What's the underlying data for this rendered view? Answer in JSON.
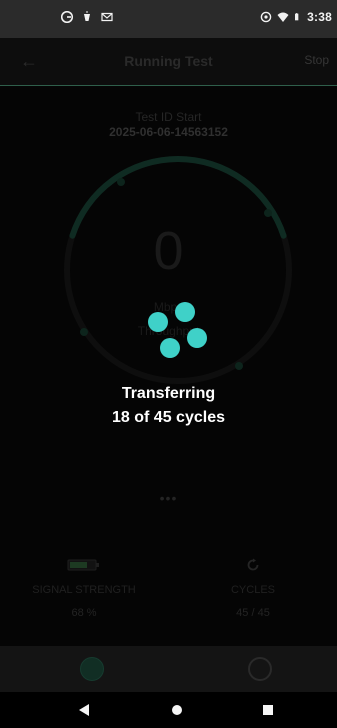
{
  "status_bar": {
    "time": "3:38",
    "left_icons": [
      "google-icon",
      "silent-icon",
      "gmail-icon"
    ],
    "right_icons": [
      "sync-icon",
      "wifi-icon",
      "battery-icon"
    ]
  },
  "header": {
    "title": "Running Test",
    "action_label": "Stop"
  },
  "test": {
    "label": "Test ID Start",
    "id": "2025-06-06-14563152"
  },
  "gauge": {
    "value": "0",
    "unit_line_1": "Mbps",
    "unit_line_2": "Throughput",
    "progress": 0.4
  },
  "dots": "•••",
  "metrics": [
    {
      "icon": "battery-icon",
      "label": "SIGNAL STRENGTH",
      "value": "68 %"
    },
    {
      "icon": "refresh-icon",
      "label": "CYCLES",
      "value": "45 / 45"
    }
  ],
  "overlay": {
    "line_1": "Transferring",
    "line_2": "18 of 45 cycles"
  },
  "tabs": [
    {
      "icon": "home-icon"
    },
    {
      "icon": "chat-icon"
    }
  ],
  "colors": {
    "accent": "#3fd1c8",
    "dim_green": "#163b2f",
    "background": "#050505"
  }
}
